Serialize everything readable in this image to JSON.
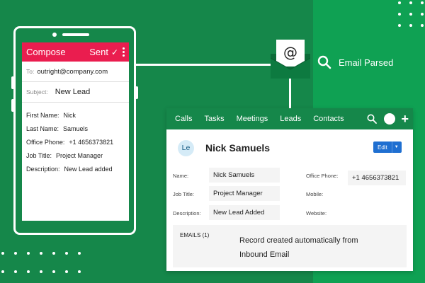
{
  "phone": {
    "compose_title": "Compose",
    "sent_label": "Sent",
    "check_icon": "check-icon",
    "to_label": "To:",
    "to_value": "outright@company.com",
    "subject_label": "Subject:",
    "subject_value": "New Lead",
    "fields": [
      {
        "label": "First Name:",
        "value": "Nick"
      },
      {
        "label": "Last Name:",
        "value": "Samuels"
      },
      {
        "label": "Office Phone:",
        "value": "+1 4656373821"
      },
      {
        "label": "Job Title:",
        "value": "Project Manager"
      },
      {
        "label": "Description:",
        "value": "New Lead added"
      }
    ]
  },
  "parsed": {
    "email_glyph": "@",
    "label": "Email Parsed",
    "icon": "search-icon"
  },
  "crm": {
    "nav": [
      "Calls",
      "Tasks",
      "Meetings",
      "Leads",
      "Contacts"
    ],
    "avatar_initials": "Le",
    "record_name": "Nick Samuels",
    "edit_label": "Edit",
    "fields": {
      "name_label": "Name:",
      "name_value": "Nick Samuels",
      "job_label": "Job Title:",
      "job_value": "Project Manager",
      "desc_label": "Description:",
      "desc_value": "New Lead Added",
      "phone_label": "Office Phone:",
      "phone_value": "+1 4656373821",
      "mobile_label": "Mobile:",
      "website_label": "Website:"
    },
    "emails_label": "EMAILS (1)",
    "emails_message": "Record created automatically from Inbound Email"
  },
  "colors": {
    "background": "#15874a",
    "background_right": "#0fa153",
    "compose_bar": "#ea1d4f",
    "edit_button": "#1f6fd1"
  }
}
